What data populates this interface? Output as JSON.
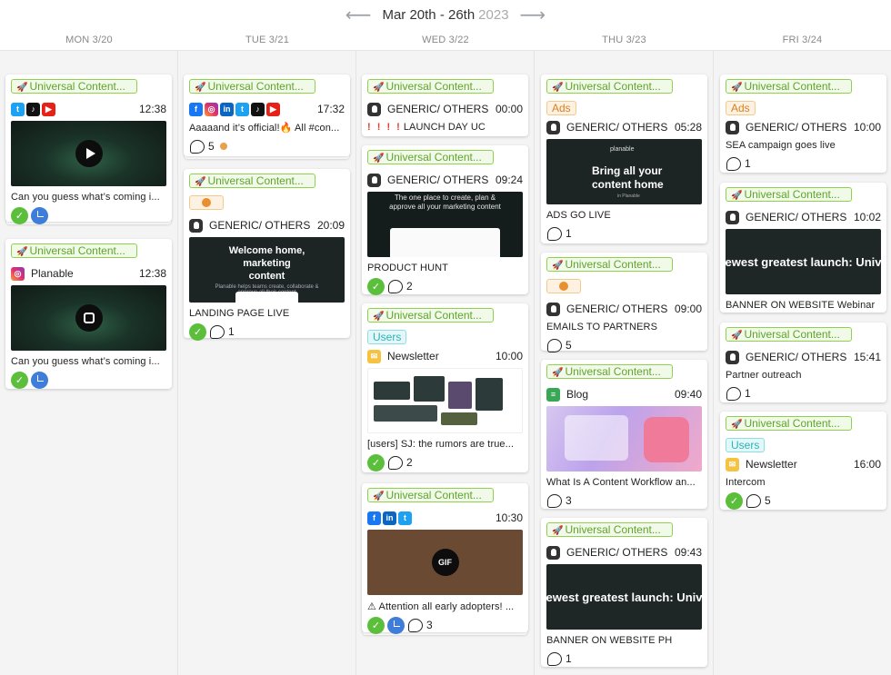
{
  "header": {
    "prev_icon": "arrow-left-icon",
    "next_icon": "arrow-right-icon",
    "range": "Mar 20th - 26th",
    "year": "2023"
  },
  "days": [
    "MON 3/20",
    "TUE 3/21",
    "WED 3/22",
    "THU 3/23",
    "FRI 3/24"
  ],
  "tag_label": "Universal Content...",
  "cards": {
    "mon1": {
      "time": "12:38",
      "caption": "Can you guess what’s coming i..."
    },
    "mon2": {
      "name": "Planable",
      "time": "12:38",
      "caption": "Can you guess what’s coming i..."
    },
    "tue1": {
      "time": "17:32",
      "caption": "Aaaaand it’s official!🔥 All #con...",
      "comments": "5"
    },
    "tue2": {
      "name": "GENERIC/ OTHERS",
      "time": "20:09",
      "thumb_title": "Welcome home, marketing content",
      "thumb_sub": "Planable helps teams create, collaborate & approve all their content",
      "caption": "LANDING PAGE LIVE",
      "comments": "1"
    },
    "wed1": {
      "name": "GENERIC/ OTHERS",
      "time": "00:00",
      "bangs": "! ! ! !",
      "caption": "LAUNCH DAY UC"
    },
    "wed2": {
      "name": "GENERIC/ OTHERS",
      "time": "09:24",
      "thumb_title": "The one place to create, plan & approve all your marketing content",
      "caption": "PRODUCT HUNT",
      "comments": "2"
    },
    "wed3": {
      "chip": "Users",
      "name": "Newsletter",
      "time": "10:00",
      "caption": "[users] SJ: the rumors are true...",
      "comments": "2"
    },
    "wed4": {
      "time": "10:30",
      "gif": "GIF",
      "caption": "⚠ Attention all early adopters! ...",
      "comments": "3"
    },
    "thu1": {
      "chip": "Ads",
      "name": "GENERIC/ OTHERS",
      "time": "05:28",
      "thumb_logo": "planable",
      "thumb_title": "Bring all your content home",
      "thumb_sub": "in Planable",
      "caption": "ADS GO LIVE",
      "comments": "1"
    },
    "thu2": {
      "name": "GENERIC/ OTHERS",
      "time": "09:00",
      "caption": "EMAILS TO PARTNERS",
      "comments": "5"
    },
    "thu3": {
      "name": "Blog",
      "time": "09:40",
      "caption": "What Is A Content Workflow an...",
      "comments": "3"
    },
    "thu4": {
      "name": "GENERIC/ OTHERS",
      "time": "09:43",
      "thumb_title": "ewest greatest launch: Univ",
      "caption": "BANNER ON WEBSITE PH",
      "comments": "1"
    },
    "fri1": {
      "chip": "Ads",
      "name": "GENERIC/ OTHERS",
      "time": "10:00",
      "caption": "SEA campaign goes live",
      "comments": "1"
    },
    "fri2": {
      "name": "GENERIC/ OTHERS",
      "time": "10:02",
      "thumb_title": "ewest greatest launch: Univ",
      "caption": "BANNER ON WEBSITE Webinar"
    },
    "fri3": {
      "name": "GENERIC/ OTHERS",
      "time": "15:41",
      "caption": "Partner outreach",
      "comments": "1"
    },
    "fri4": {
      "chip": "Users",
      "name": "Newsletter",
      "time": "16:00",
      "caption": "Intercom",
      "comments": "5"
    }
  },
  "colors": {
    "tag_green": "#5fa52a",
    "approved": "#5cbf3c",
    "scheduled": "#3e7dd9",
    "ads": "#d98020",
    "users": "#2bb3b9"
  }
}
